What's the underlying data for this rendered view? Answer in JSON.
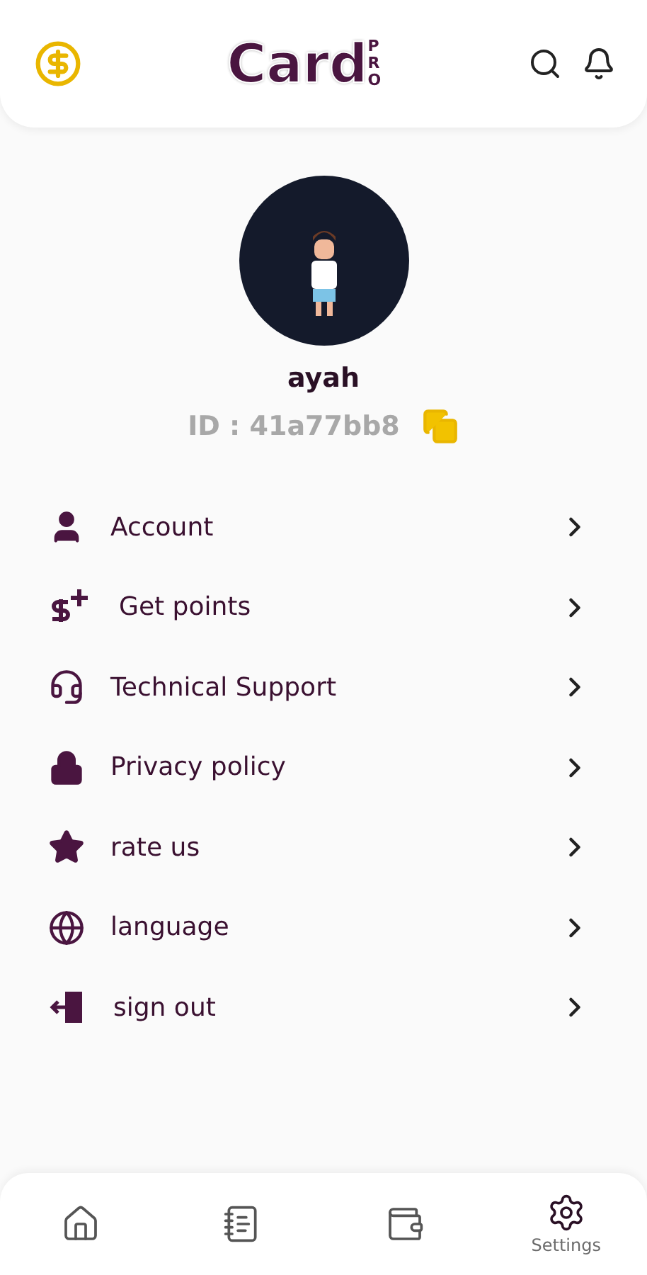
{
  "header": {
    "logo": {
      "main": "Card",
      "sub": "PRO"
    }
  },
  "profile": {
    "name": "ayah",
    "id": "ID : 41a77bb8"
  },
  "menu": [
    {
      "kind": "account",
      "label": "Account"
    },
    {
      "kind": "points",
      "label": "Get points"
    },
    {
      "kind": "support",
      "label": "Technical Support"
    },
    {
      "kind": "privacy",
      "label": "Privacy policy"
    },
    {
      "kind": "rate",
      "label": "rate us"
    },
    {
      "kind": "language",
      "label": "language"
    },
    {
      "kind": "signout",
      "label": "sign out"
    }
  ],
  "bottom_nav": [
    {
      "kind": "home",
      "selected": false
    },
    {
      "kind": "orders",
      "selected": false
    },
    {
      "kind": "wallet",
      "selected": false
    },
    {
      "kind": "settings",
      "label": "Settings",
      "selected": true
    }
  ]
}
